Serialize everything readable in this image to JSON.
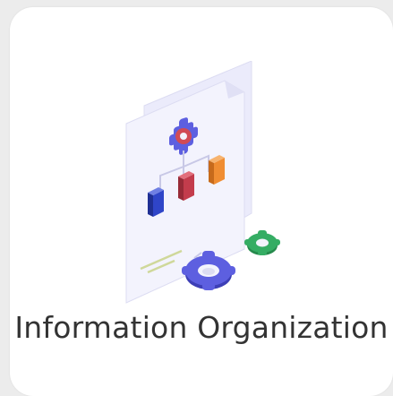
{
  "card": {
    "title": "Information Organization",
    "icon": "information-organization-icon"
  },
  "colors": {
    "card_background": "#ffffff",
    "page_background": "#ececec",
    "text": "#333333",
    "document": "#f1f1fc",
    "document_edge": "#dcdcf2",
    "gear_purple": "#5d5fe0",
    "gear_red": "#d14a55",
    "node_blue": "#2f45c8",
    "node_red": "#c33c4c",
    "node_orange": "#f08d32",
    "gear_green": "#35ad64",
    "connector": "#c8c8e6"
  }
}
